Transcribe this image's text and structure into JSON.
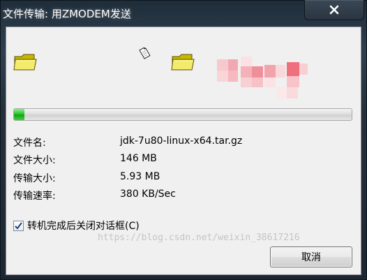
{
  "window": {
    "title": "文件传输: 用ZMODEM发送",
    "close_icon": "close-icon"
  },
  "transfer": {
    "progress_fraction": 0.03,
    "progress_color": "#29c02a",
    "source_icon": "folder-icon",
    "destination_icon": "folder-icon",
    "moving_icon": "document-icon"
  },
  "info": [
    {
      "label": "文件名:",
      "value": "jdk-7u80-linux-x64.tar.gz"
    },
    {
      "label": "文件大小:",
      "value": "146 MB"
    },
    {
      "label": "传输大小:",
      "value": "5.93 MB"
    },
    {
      "label": "传输速率:",
      "value": "380 KB/Sec"
    }
  ],
  "options": {
    "close_on_finish_label": "转机完成后关闭对话框(C)",
    "close_on_finish_checked": true
  },
  "buttons": {
    "cancel_label": "取消"
  },
  "watermark": "https://blog.csdn.net/weixin_38617216"
}
